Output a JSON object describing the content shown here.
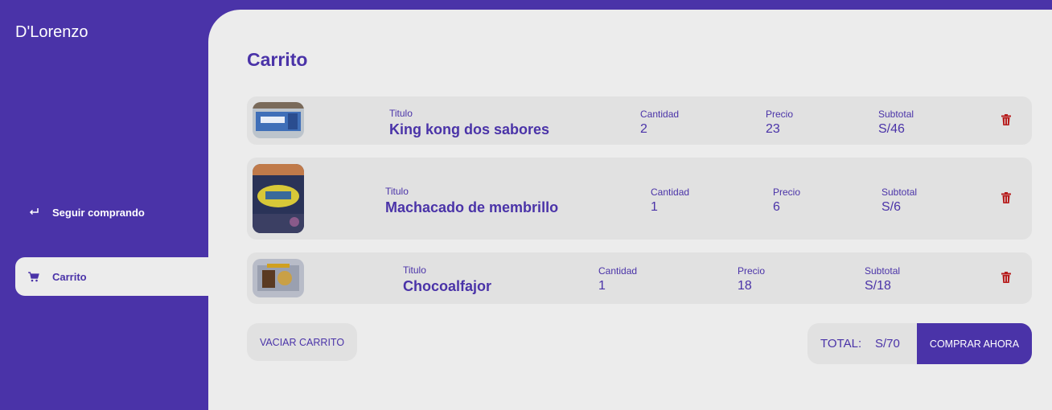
{
  "sidebar": {
    "logo": "D'Lorenzo",
    "items": [
      {
        "label": "Seguir comprando",
        "icon": "return-arrow-icon"
      },
      {
        "label": "Carrito",
        "icon": "cart-icon",
        "active": true
      }
    ]
  },
  "main": {
    "title": "Carrito",
    "column_labels": {
      "title": "Titulo",
      "qty": "Cantidad",
      "price": "Precio",
      "subtotal": "Subtotal"
    },
    "items": [
      {
        "title": "King kong dos sabores",
        "qty": "2",
        "price": "23",
        "subtotal": "S/46"
      },
      {
        "title": "Machacado de membrillo",
        "qty": "1",
        "price": "6",
        "subtotal": "S/6"
      },
      {
        "title": "Chocoalfajor",
        "qty": "1",
        "price": "18",
        "subtotal": "S/18"
      }
    ],
    "empty_cart_label": "VACIAR CARRITO",
    "total_label": "TOTAL:",
    "total_value": "S/70",
    "buy_label": "COMPRAR AHORA"
  },
  "colors": {
    "brand": "#4a33a8",
    "background": "#ececec",
    "row": "#e1e1e1",
    "delete": "#b71c1c"
  }
}
